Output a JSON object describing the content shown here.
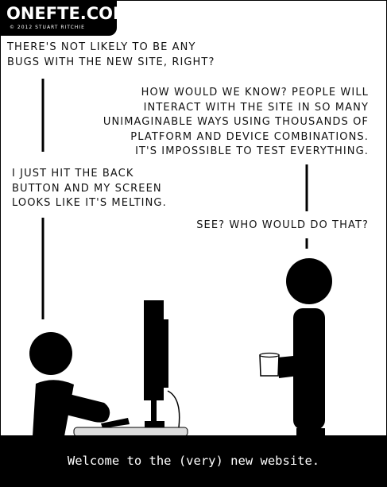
{
  "logo": {
    "title": "ONEFTE.COM",
    "copyright": "© 2012 STUART RITCHIE"
  },
  "dialogue": {
    "line1": "There's not likely to be any\nbugs with the new site, right?",
    "line2": "How would we know? People will\ninteract with the site in so many\nunimaginable ways using thousands of\nplatform and device combinations.\nIt's impossible to test everything.",
    "line3": "I just hit the back\nbutton and my screen\nlooks like it's melting.",
    "line4": "See? Who would do that?"
  },
  "caption": "Welcome to the (very) new website."
}
